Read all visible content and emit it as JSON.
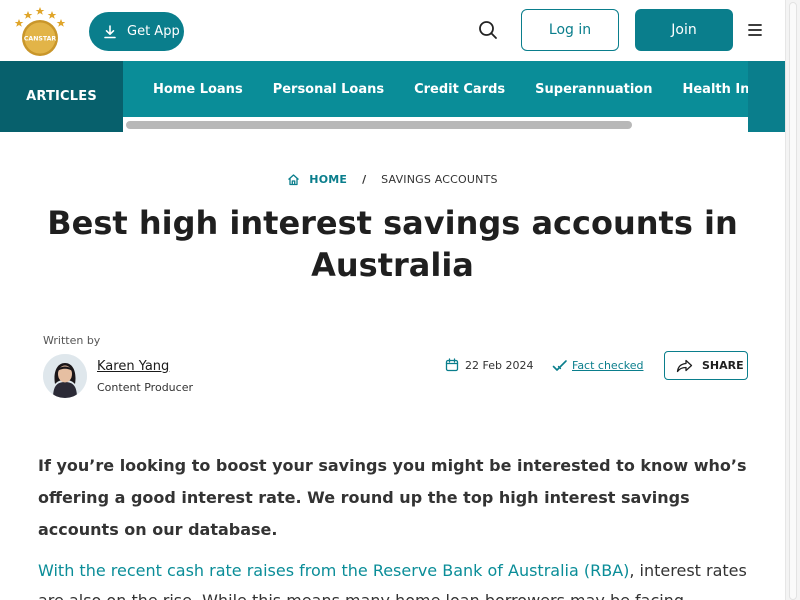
{
  "header": {
    "logo_text": "CANSTAR",
    "get_app_label": "Get App",
    "login_label": "Log in",
    "join_label": "Join"
  },
  "nav": {
    "section_label": "ARTICLES",
    "links": [
      "Home Loans",
      "Personal Loans",
      "Credit Cards",
      "Superannuation",
      "Health Insurance"
    ]
  },
  "breadcrumb": {
    "home": "HOME",
    "separator": "/",
    "current": "SAVINGS ACCOUNTS"
  },
  "article": {
    "title": "Best high interest savings accounts in Australia",
    "written_by": "Written by",
    "author_name": "Karen Yang",
    "author_role": "Content Producer",
    "date": "22 Feb 2024",
    "fact_checked": "Fact checked",
    "share_label": "SHARE",
    "intro": "If you’re looking to boost your savings you might be interested to know who’s offering a good interest rate. We round up the top high interest savings accounts on our database.",
    "para2_link": "With the recent cash rate raises from the Reserve Bank of Australia (RBA)",
    "para2_rest": ", interest rates are also on the rise. While this means many home loan borrowers may be facing"
  },
  "colors": {
    "brand": "#0a7e8c",
    "nav_dark": "#07606c",
    "link": "#0a8d98"
  },
  "icons": [
    "logo-icon",
    "download-icon",
    "search-icon",
    "menu-icon",
    "home-icon",
    "calendar-icon",
    "check-icon",
    "share-icon"
  ]
}
